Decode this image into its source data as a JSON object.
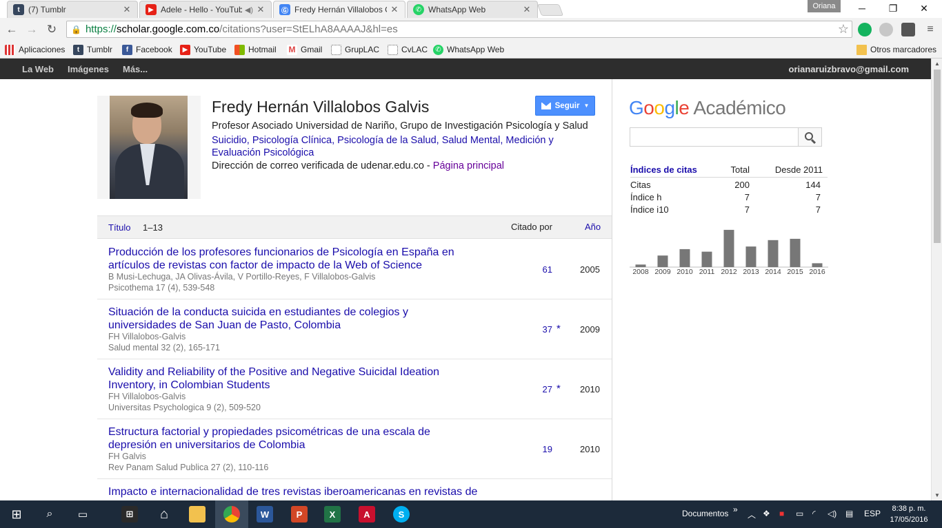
{
  "browser": {
    "tabs": [
      {
        "label": "(7) Tumblr",
        "icon": "tumblr-icon",
        "color": "#36465d"
      },
      {
        "label": "Adele - Hello - YouTub",
        "icon": "youtube-icon",
        "color": "#e62117"
      },
      {
        "label": "Fredy Hernán Villalobos G",
        "icon": "scholar-icon",
        "color": "#4285f4"
      },
      {
        "label": "WhatsApp Web",
        "icon": "whatsapp-icon",
        "color": "#25d366"
      }
    ],
    "profile_name": "Oriana",
    "url": {
      "scheme": "https://",
      "host": "scholar.google.com.co",
      "path": "/citations?user=StELhA8AAAAJ&hl=es"
    }
  },
  "bookmarks": {
    "items": [
      {
        "label": "Aplicaciones",
        "icon": "apps-icon"
      },
      {
        "label": "Tumblr",
        "icon": "tumblr-icon"
      },
      {
        "label": "Facebook",
        "icon": "facebook-icon"
      },
      {
        "label": "YouTube",
        "icon": "youtube-icon"
      },
      {
        "label": "Hotmail",
        "icon": "hotmail-icon"
      },
      {
        "label": "Gmail",
        "icon": "gmail-icon"
      },
      {
        "label": "GrupLAC",
        "icon": "gruplac-icon"
      },
      {
        "label": "CvLAC",
        "icon": "cvlac-icon"
      },
      {
        "label": "WhatsApp Web",
        "icon": "whatsapp-icon"
      }
    ],
    "other": "Otros marcadores"
  },
  "gbar": {
    "links": [
      "La Web",
      "Imágenes",
      "Más..."
    ],
    "email": "orianaruizbravo@gmail.com"
  },
  "profile": {
    "name": "Fredy Hernán Villalobos Galvis",
    "affiliation": "Profesor Asociado Universidad de Nariño, Grupo de Investigación Psicología y Salud",
    "interests": [
      "Suicidio",
      "Psicología Clínica",
      "Psicología de la Salud",
      "Salud Mental",
      "Medición y Evaluación Psicológica"
    ],
    "email_text": "Dirección de correo verificada de udenar.edu.co",
    "email_sep": " - ",
    "homepage": "Página principal",
    "follow": "Seguir"
  },
  "table": {
    "header": {
      "title": "Título",
      "range": "1–13",
      "cited": "Citado por",
      "year": "Año"
    },
    "rows": [
      {
        "title": "Producción de los profesores funcionarios de Psicología en España en artículos de revistas con factor de impacto de la Web of Science",
        "authors": "B Musi-Lechuga, JA Olivas-Ávila, V Portillo-Reyes, F Villalobos-Galvis",
        "source": "Psicothema 17 (4), 539-548",
        "cited": "61",
        "star": "",
        "year": "2005"
      },
      {
        "title": "Situación de la conducta suicida en estudiantes de colegios y universidades de San Juan de Pasto, Colombia",
        "authors": "FH Villalobos-Galvis",
        "source": "Salud mental 32 (2), 165-171",
        "cited": "37",
        "star": "*",
        "year": "2009"
      },
      {
        "title": "Validity and Reliability of the Positive and Negative Suicidal Ideation Inventory, in Colombian Students",
        "authors": "FH Villalobos-Galvis",
        "source": "Universitas Psychologica 9 (2), 509-520",
        "cited": "27",
        "star": "*",
        "year": "2010"
      },
      {
        "title": "Estructura factorial y propiedades psicométricas de una escala de depresión en universitarios de Colombia",
        "authors": "FH Galvis",
        "source": "Rev Panam Salud Publica 27 (2), 110-116",
        "cited": "19",
        "star": "",
        "year": "2010"
      },
      {
        "title": "Impacto e internacionalidad de tres revistas iberoamericanas en revistas de",
        "authors": "",
        "source": "",
        "cited": "",
        "star": "",
        "year": ""
      }
    ]
  },
  "scholar": {
    "logo_word": "Google",
    "product": "Académico",
    "search_placeholder": "",
    "metrics": {
      "header": [
        "Índices de citas",
        "Total",
        "Desde 2011"
      ],
      "rows": [
        [
          "Citas",
          "200",
          "144"
        ],
        [
          "Índice h",
          "7",
          "7"
        ],
        [
          "Índice i10",
          "7",
          "7"
        ]
      ]
    }
  },
  "chart_data": {
    "type": "bar",
    "categories": [
      "2008",
      "2009",
      "2010",
      "2011",
      "2012",
      "2013",
      "2014",
      "2015",
      "2016"
    ],
    "values": [
      2,
      9,
      14,
      12,
      29,
      16,
      21,
      22,
      3
    ],
    "ylim": [
      0,
      30
    ],
    "color": "#777777"
  },
  "taskbar": {
    "folder_label": "Documentos",
    "lang": "ESP",
    "time": "8:38 p. m.",
    "date": "17/05/2016"
  }
}
